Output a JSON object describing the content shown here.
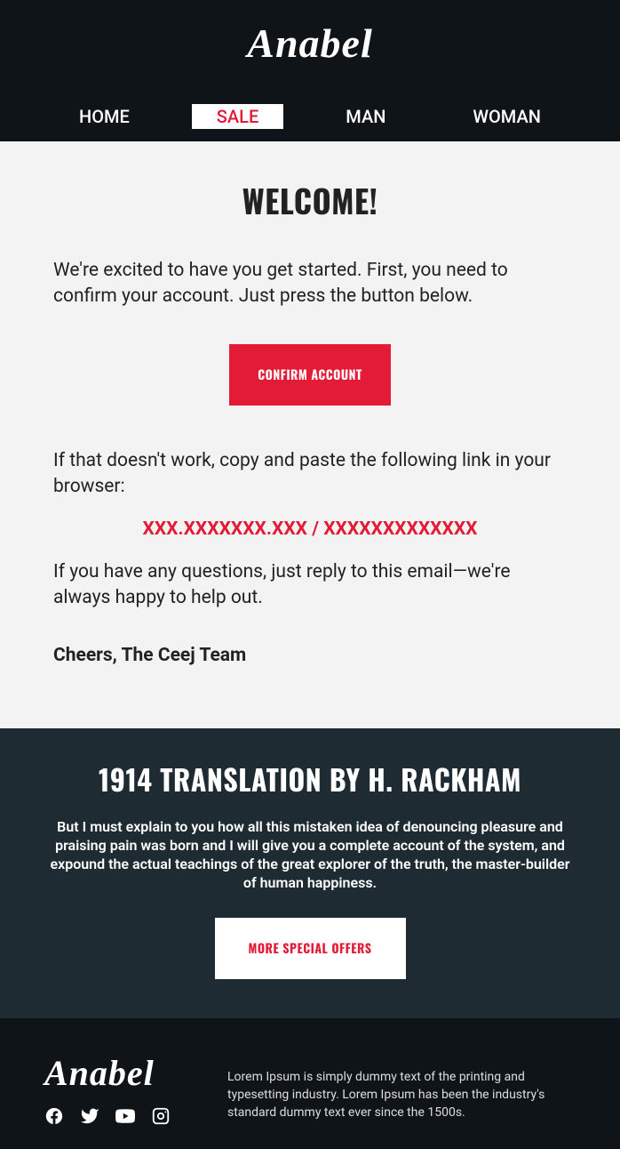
{
  "brand": "Anabel",
  "nav": {
    "items": [
      {
        "label": "HOME",
        "active": false
      },
      {
        "label": "SALE",
        "active": true
      },
      {
        "label": "MAN",
        "active": false
      },
      {
        "label": "WOMAN",
        "active": false
      }
    ]
  },
  "main": {
    "title": "WELCOME!",
    "intro": "We're excited to have you get started. First, you need to confirm your account. Just press the button below.",
    "confirm_label": "CONFIRM ACCOUNT",
    "fallback_text": "If that doesn't work, copy and paste the following link in your browser:",
    "fallback_link": "XXX.XXXXXXX.XXX / XXXXXXXXXXXXX",
    "help_text": "If you have any questions, just reply to this email—we're always happy to help out.",
    "sign_off": "Cheers, The Ceej Team"
  },
  "promo": {
    "title": "1914 TRANSLATION BY H. RACKHAM",
    "body": "But I must explain to you how all this mistaken idea of denouncing pleasure and praising pain was born and I will give you a complete account of the system, and expound the actual teachings of the great explorer of the truth, the master-builder of human happiness.",
    "button_label": "MORE SPECIAL OFFERS"
  },
  "footer": {
    "brand": "Anabel",
    "about": "Lorem Ipsum is simply dummy text of the printing and typesetting industry. Lorem Ipsum has been the industry's standard dummy text ever since the 1500s.",
    "social": {
      "facebook": "facebook-icon",
      "twitter": "twitter-icon",
      "youtube": "youtube-icon",
      "instagram": "instagram-icon"
    }
  },
  "colors": {
    "accent": "#e31b37",
    "dark": "#0f1419",
    "slate": "#1f2b33",
    "bg": "#f3f3f3"
  }
}
